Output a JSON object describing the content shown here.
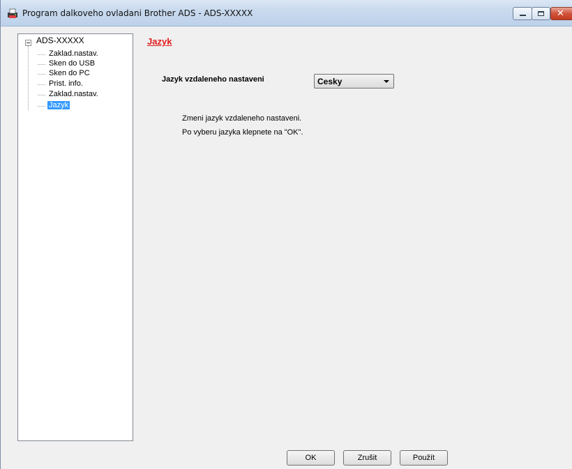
{
  "window": {
    "title": "Program dalkoveho ovladani Brother ADS - ADS-XXXXX"
  },
  "tree": {
    "root": "ADS-XXXXX",
    "items": [
      {
        "label": "Zaklad.nastav."
      },
      {
        "label": "Sken do USB"
      },
      {
        "label": "Sken do PC"
      },
      {
        "label": "Prist. info."
      },
      {
        "label": "Zaklad.nastav."
      },
      {
        "label": "Jazyk",
        "selected": true
      }
    ]
  },
  "main": {
    "section_title": "Jazyk",
    "field_label": "Jazyk vzdaleneho nastaveni",
    "language_select": {
      "value": "Cesky"
    },
    "description": [
      "Zmeni jazyk vzdaleneho nastaveni.",
      "Po vyberu jazyka klepnete na \"OK\"."
    ]
  },
  "buttons": {
    "ok": "OK",
    "cancel": "Zrušit",
    "apply": "Použít"
  },
  "colors": {
    "section_title": "#e31b1b",
    "selection": "#3399ff"
  }
}
